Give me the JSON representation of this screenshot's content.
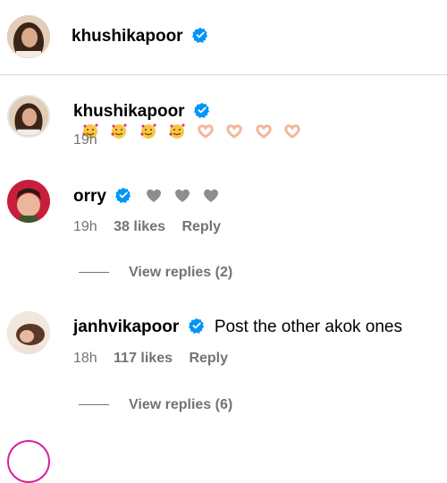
{
  "post_header": {
    "username": "khushikapoor"
  },
  "comments": [
    {
      "username": "khushikapoor",
      "text": "",
      "emojis": [
        "smiling-face-with-hearts",
        "smiling-face-with-hearts",
        "smiling-face-with-hearts",
        "smiling-face-with-hearts",
        "heart-hands",
        "heart-hands",
        "heart-hands",
        "heart-hands"
      ],
      "time": "19h"
    },
    {
      "username": "orry",
      "text": "",
      "emojis": [
        "grey-heart",
        "grey-heart",
        "grey-heart"
      ],
      "time": "19h",
      "likes": "38 likes",
      "reply": "Reply",
      "view_replies": "View replies (2)"
    },
    {
      "username": "janhvikapoor",
      "text": "Post the other akok ones",
      "time": "18h",
      "likes": "117 likes",
      "reply": "Reply",
      "view_replies": "View replies (6)"
    }
  ],
  "colors": {
    "verified": "#0095f6",
    "muted": "#737373",
    "divider": "#dbdbdb"
  }
}
